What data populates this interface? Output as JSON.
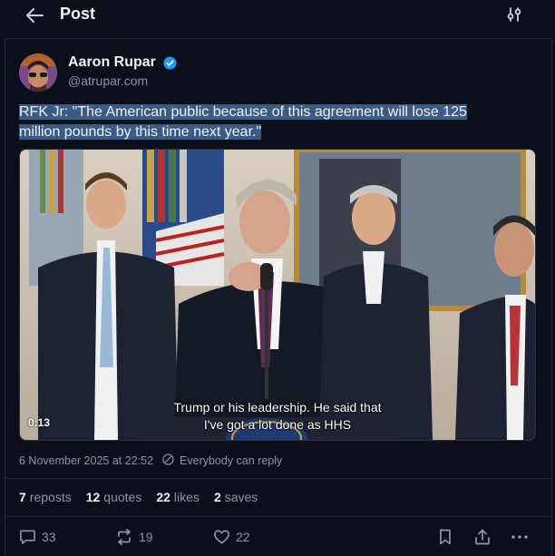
{
  "header": {
    "title": "Post",
    "back_icon": "arrow-left-icon",
    "filter_icon": "sliders-icon"
  },
  "author": {
    "name": "Aaron Rupar",
    "handle": "@atrupar.com",
    "verified_color": "#1d9bf0"
  },
  "post": {
    "text_line1": "RFK Jr: \"The American public because of this agreement will lose 125",
    "text_line2": "million pounds by this time next year.\"",
    "highlight_color": "#3a5b86"
  },
  "video": {
    "caption_line1": "Trump or his leadership. He said that",
    "caption_line2": "I've got a lot done as HHS",
    "duration": "0:13"
  },
  "meta": {
    "timestamp": "6 November 2025 at 22:52",
    "reply_setting": "Everybody can reply"
  },
  "stats": {
    "reposts_count": "7",
    "reposts_label": "reposts",
    "quotes_count": "12",
    "quotes_label": "quotes",
    "likes_count": "22",
    "likes_label": "likes",
    "saves_count": "2",
    "saves_label": "saves"
  },
  "actions": {
    "reply_count": "33",
    "repost_count": "19",
    "like_count": "22"
  }
}
